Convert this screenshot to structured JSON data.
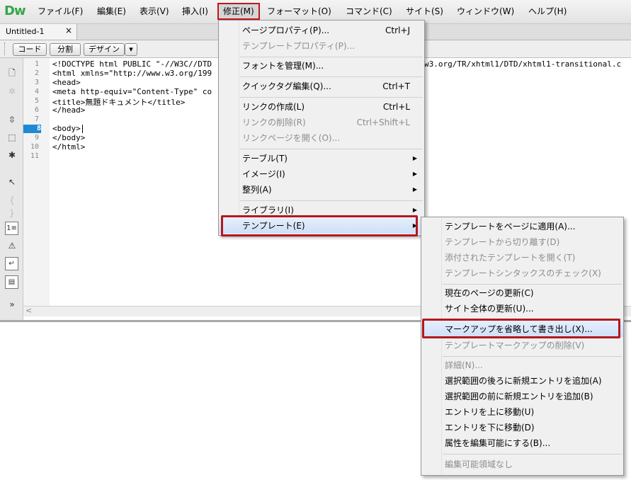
{
  "app": {
    "logo": "Dw"
  },
  "menubar": {
    "items": [
      "ファイル(F)",
      "編集(E)",
      "表示(V)",
      "挿入(I)",
      "修正(M)",
      "フォーマット(O)",
      "コマンド(C)",
      "サイト(S)",
      "ウィンドウ(W)",
      "ヘルプ(H)"
    ],
    "active": "修正(M)"
  },
  "document": {
    "tab": "Untitled-1",
    "close": "×"
  },
  "viewbar": {
    "code": "コード",
    "split": "分割",
    "design": "デザイン",
    "dropdown": "▾"
  },
  "editor": {
    "line_numbers": [
      "1",
      "2",
      "3",
      "4",
      "5",
      "6",
      "7",
      "8",
      "9",
      "10",
      "11"
    ],
    "current_line": "8",
    "lines": [
      "<!DOCTYPE html PUBLIC \"-//W3C//DTD",
      "<html xmlns=\"http://www.w3.org/199",
      "<head>",
      "<meta http-equiv=\"Content-Type\" co",
      "<title>無題ドキュメント</title>",
      "</head>",
      "",
      "<body>",
      "</body>",
      "</html>",
      ""
    ],
    "overflow_text": "w3.org/TR/xhtml1/DTD/xhtml1-transitional.c",
    "scroll_arrow": "<"
  },
  "modify_menu": {
    "items": [
      {
        "label": "ページプロパティ(P)...",
        "shortcut": "Ctrl+J",
        "disabled": false
      },
      {
        "label": "テンプレートプロパティ(P)...",
        "shortcut": "",
        "disabled": true
      },
      {
        "label": "フォントを管理(M)...",
        "shortcut": "",
        "disabled": false
      },
      {
        "label": "クイックタグ編集(Q)...",
        "shortcut": "Ctrl+T",
        "disabled": false
      },
      {
        "label": "リンクの作成(L)",
        "shortcut": "Ctrl+L",
        "disabled": false
      },
      {
        "label": "リンクの削除(R)",
        "shortcut": "Ctrl+Shift+L",
        "disabled": true
      },
      {
        "label": "リンクページを開く(O)...",
        "shortcut": "",
        "disabled": true
      },
      {
        "label": "テーブル(T)",
        "submenu": true,
        "disabled": false
      },
      {
        "label": "イメージ(I)",
        "submenu": true,
        "disabled": false
      },
      {
        "label": "整列(A)",
        "submenu": true,
        "disabled": false
      },
      {
        "label": "ライブラリ(I)",
        "submenu": true,
        "disabled": false
      },
      {
        "label": "テンプレート(E)",
        "submenu": true,
        "disabled": false,
        "highlighted": true
      }
    ]
  },
  "template_menu": {
    "items": [
      {
        "label": "テンプレートをページに適用(A)...",
        "disabled": false
      },
      {
        "label": "テンプレートから切り離す(D)",
        "disabled": true
      },
      {
        "label": "添付されたテンプレートを開く(T)",
        "disabled": true
      },
      {
        "label": "テンプレートシンタックスのチェック(X)",
        "disabled": true
      },
      {
        "label": "現在のページの更新(C)",
        "disabled": false
      },
      {
        "label": "サイト全体の更新(U)...",
        "disabled": false
      },
      {
        "label": "マークアップを省略して書き出し(X)...",
        "disabled": false,
        "highlighted": true
      },
      {
        "label": "テンプレートマークアップの削除(V)",
        "disabled": true
      },
      {
        "label": "詳細(N)...",
        "disabled": true
      },
      {
        "label": "選択範囲の後ろに新規エントリを追加(A)",
        "disabled": false
      },
      {
        "label": "選択範囲の前に新規エントリを追加(B)",
        "disabled": false
      },
      {
        "label": "エントリを上に移動(U)",
        "disabled": false
      },
      {
        "label": "エントリを下に移動(D)",
        "disabled": false
      },
      {
        "label": "属性を編集可能にする(B)...",
        "disabled": false
      },
      {
        "label": "編集可能領域なし",
        "disabled": true
      }
    ]
  },
  "colors": {
    "highlight_border": "#b3181d",
    "logo": "#35a54a",
    "current_line": "#1e8ad6"
  }
}
